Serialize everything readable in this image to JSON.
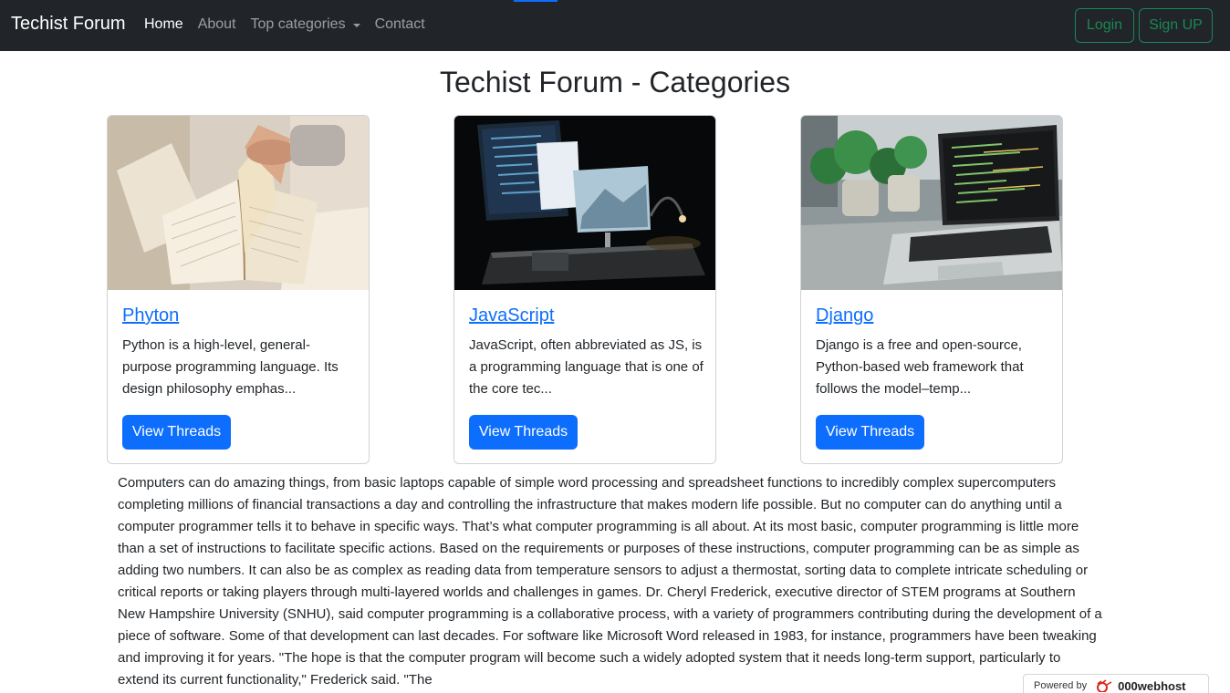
{
  "navbar": {
    "brand": "Techist Forum",
    "links": [
      "Home",
      "About",
      "Top categories",
      "Contact"
    ],
    "login_label": "Login",
    "signup_label": "Sign UP"
  },
  "page": {
    "title": "Techist Forum - Categories"
  },
  "cards": [
    {
      "title": "Phyton",
      "description": "Python is a high-level, general-purpose programming language. Its design philosophy emphas...",
      "button_label": "View Threads"
    },
    {
      "title": "JavaScript",
      "description": "JavaScript, often abbreviated as JS, is a programming language that is one of the core tec...",
      "button_label": "View Threads"
    },
    {
      "title": "Django",
      "description": "Django is a free and open-source, Python-based web framework that follows the model–temp...",
      "button_label": "View Threads"
    }
  ],
  "about": {
    "text": "Computers can do amazing things, from basic laptops capable of simple word processing and spreadsheet functions to incredibly complex supercomputers completing millions of financial transactions a day and controlling the infrastructure that makes modern life possible. But no computer can do anything until a computer programmer tells it to behave in specific ways. That’s what computer programming is all about. At its most basic, computer programming is little more than a set of instructions to facilitate specific actions. Based on the requirements or purposes of these instructions, computer programming can be as simple as adding two numbers. It can also be as complex as reading data from temperature sensors to adjust a thermostat, sorting data to complete intricate scheduling or critical reports or taking players through multi-layered worlds and challenges in games. Dr. Cheryl Frederick, executive director of STEM programs at Southern New Hampshire University (SNHU), said computer programming is a collaborative process, with a variety of programmers contributing during the development of a piece of software. Some of that development can last decades. For software like Microsoft Word released in 1983, for instance, programmers have been tweaking and improving it for years. \"The hope is that the computer program will become such a widely adopted system that it needs long-term support, particularly to extend its current functionality,\" Frederick said. \"The"
  },
  "hosting_badge": {
    "prefix": "Powered by",
    "brand": "000webhost"
  },
  "colors": {
    "navbar_bg": "#212529",
    "primary": "#0d6efd",
    "success": "#198754"
  }
}
